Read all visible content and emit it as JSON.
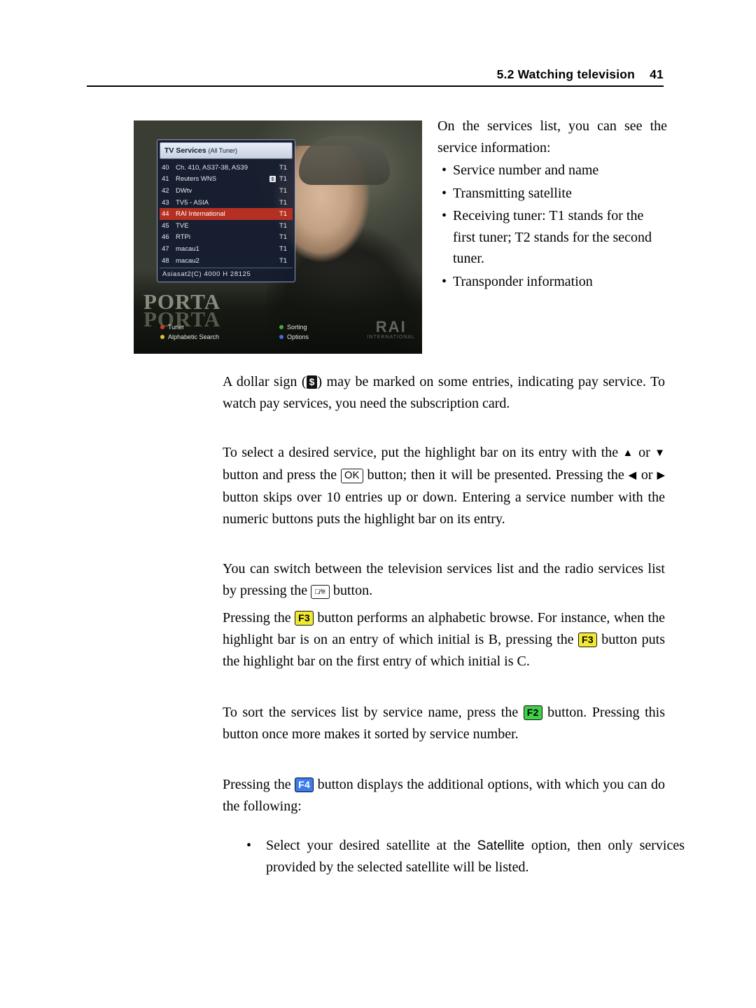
{
  "header": {
    "section": "5.2 Watching television",
    "page_number": "41"
  },
  "figure": {
    "osd": {
      "title_main": "TV Services",
      "title_sub": "(All Tuner)",
      "rows": [
        {
          "num": "40",
          "name": "Ch. 410, AS37-38, AS39",
          "pay": false,
          "tuner": "T1",
          "selected": false
        },
        {
          "num": "41",
          "name": "Reuters WNS",
          "pay": true,
          "tuner": "T1",
          "selected": false
        },
        {
          "num": "42",
          "name": "DWtv",
          "pay": false,
          "tuner": "T1",
          "selected": false
        },
        {
          "num": "43",
          "name": "TV5 - ASIA",
          "pay": false,
          "tuner": "T1",
          "selected": false
        },
        {
          "num": "44",
          "name": "RAI International",
          "pay": false,
          "tuner": "T1",
          "selected": true
        },
        {
          "num": "45",
          "name": "TVE",
          "pay": false,
          "tuner": "T1",
          "selected": false
        },
        {
          "num": "46",
          "name": "RTPi",
          "pay": false,
          "tuner": "T1",
          "selected": false
        },
        {
          "num": "47",
          "name": "macau1",
          "pay": false,
          "tuner": "T1",
          "selected": false
        },
        {
          "num": "48",
          "name": "macau2",
          "pay": false,
          "tuner": "T1",
          "selected": false
        }
      ],
      "footer": "Asiasat2(C)   4000  H  28125"
    },
    "color_keys": [
      {
        "color": "red",
        "label": "Tuner"
      },
      {
        "color": "green",
        "label": "Sorting"
      },
      {
        "color": "yellow",
        "label": "Alphabetic Search"
      },
      {
        "color": "blue",
        "label": "Options"
      }
    ],
    "watermark_porta": [
      "PORTA",
      "PORTA"
    ],
    "watermark_rai": {
      "big": "RAI",
      "small": "INTERNATIONAL"
    }
  },
  "sidebar_text": {
    "intro": "On the services list, you can see the service information:",
    "bullets": [
      "Service number and name",
      "Transmitting satellite",
      "Receiving tuner: T1 stands for the first tuner; T2 stands for the second tuner.",
      "Transponder information"
    ]
  },
  "paragraphs": {
    "p1_a": "A dollar sign (",
    "p1_dollar": "$",
    "p1_b": ") may be marked on some entries, indicating pay service. To watch pay services, you need the subscription card.",
    "p2_a": "To select a desired service, put the highlight bar on its entry with the ",
    "p2_up": "▲",
    "p2_or1": " or ",
    "p2_down": "▼",
    "p2_b": " button and press the ",
    "p2_ok": "OK",
    "p2_c": " button; then it will be presented.  Pressing the ",
    "p2_left": "◀",
    "p2_or2": " or ",
    "p2_right": "▶",
    "p2_d": " button skips over 10 entries up or down. Entering a service number with the numeric buttons puts the highlight bar on its entry.",
    "p3_a": "You can switch between the television services list and the radio services list by pressing the ",
    "p3_tv": "□⁄≡",
    "p3_b": " button.",
    "p4_a": "Pressing the ",
    "p4_f3_1": "F3",
    "p4_b": " button performs an alphabetic browse.  For instance, when the highlight bar is on an entry of which initial is B, pressing the ",
    "p4_f3_2": "F3",
    "p4_c": " button puts the highlight bar on the first entry of which initial is C.",
    "p5_a": "To sort the services list by service name, press the ",
    "p5_f2": "F2",
    "p5_b": " button. Pressing this button once more makes it sorted by service number.",
    "p6_a": "Pressing the ",
    "p6_f4": "F4",
    "p6_b": " button displays the additional options, with which you can do the following:",
    "sub_a": "Select your desired satellite at the ",
    "sub_opt": "Satellite",
    "sub_b": " option, then only services provided by the selected satellite will be listed."
  }
}
